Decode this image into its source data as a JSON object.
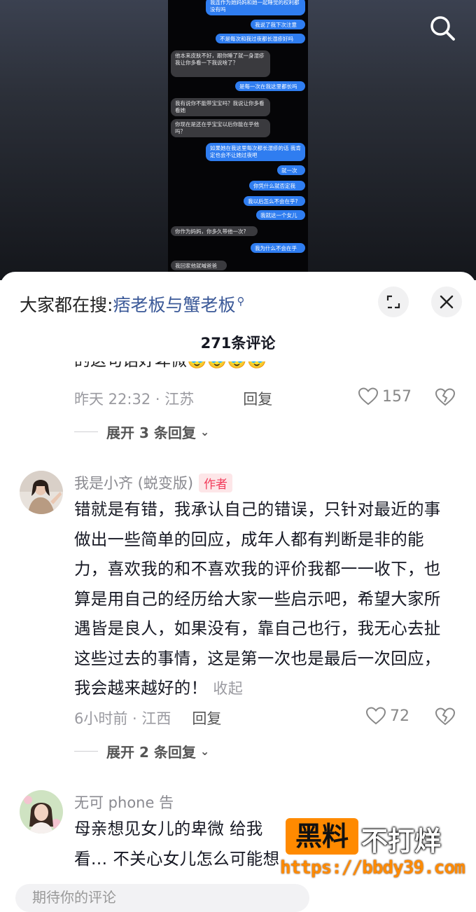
{
  "video": {
    "chat_messages": [
      {
        "side": "me",
        "text": "我连作为她妈妈和她一起睡觉的权利都没有吗"
      },
      {
        "side": "me",
        "text": "我说了我下次注意"
      },
      {
        "side": "me",
        "text": "不是每次和我过夜都长湿疹好吗"
      },
      {
        "side": "them",
        "text": "他本来皮肤不好，跟你睡了就一身湿疹\n我让你多看一下我说啥了？"
      },
      {
        "side": "me",
        "text": "是每一次在我这里都长吗"
      },
      {
        "side": "them",
        "text": "我有说你不能带宝宝吗？我说让你多看看她"
      },
      {
        "side": "them",
        "text": "你现在是还在乎宝宝以后你能在乎他吗？"
      },
      {
        "side": "me",
        "text": "如果她在我这里每次都长湿疹的话 我肯定也会不让她过夜吧"
      },
      {
        "side": "me",
        "text": "就一次"
      },
      {
        "side": "me",
        "text": "你凭什么就否定我"
      },
      {
        "side": "me",
        "text": "我以后怎么不会在乎?"
      },
      {
        "side": "me",
        "text": "我就这一个女儿"
      },
      {
        "side": "them",
        "text": "你作为妈妈，你多久带他一次?"
      },
      {
        "side": "me",
        "text": "我为什么不会在乎"
      },
      {
        "side": "them",
        "text": "我回家他就喊爸爸"
      }
    ]
  },
  "search_icon": "search-icon",
  "hot_search": {
    "prefix": "大家都在搜:",
    "keyword": "痞老板与蟹老板"
  },
  "comment_count": "271条评论",
  "comments": {
    "partial": {
      "cut_text": "的这句话好卑微🥹🥹🥹🥹",
      "time_location": "昨天 22:32 · 江苏",
      "reply_label": "回复",
      "likes": "157",
      "expand_label": "展开 3 条回复"
    },
    "author": {
      "username": "我是小齐 (蜕变版)",
      "tag": "作者",
      "text": "错就是有错，我承认自己的错误，只针对最近的事做出一些简单的回应，成年人都有判断是非的能力，喜欢我的和不喜欢我的评价我都一一收下，也算是用自己的经历给大家一些启示吧，希望大家所遇皆是良人，如果没有，靠自己也行，我无心去扯这些过去的事情，这是第一次也是最后一次回应，我会越来越好的！",
      "collapse_label": "收起",
      "time_location": "6小时前 · 江西",
      "reply_label": "回复",
      "likes": "72",
      "expand_label": "展开 2 条回复"
    },
    "third": {
      "username": "无可 phone 告",
      "text": "母亲想见女儿的卑微 给我看… 不关心女儿怎么可能想时刻见到她，抱着她睡一"
    }
  },
  "watermark": {
    "box_text": "黑料",
    "side_text": "不打烊",
    "url": "https://bbdy39.com"
  },
  "input": {
    "placeholder": "期待你的评论"
  },
  "colors": {
    "link_blue": "#3b5998",
    "author_red": "#f23c5b",
    "bubble_blue": "#2f7df0",
    "watermark_orange": "#ff8a00"
  }
}
